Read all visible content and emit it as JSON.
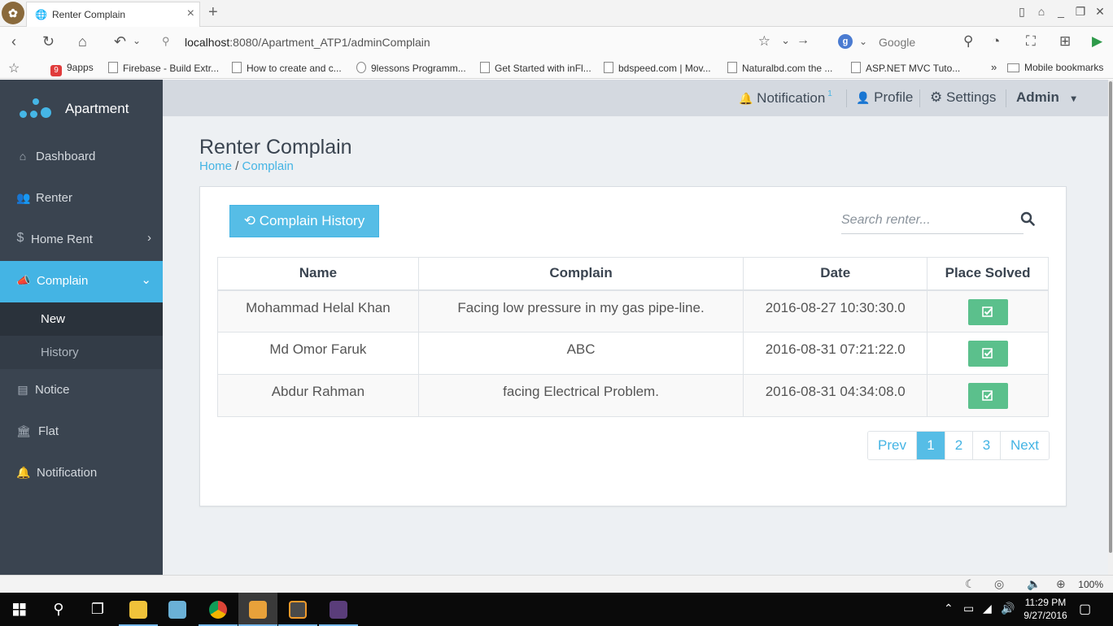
{
  "browser": {
    "tab_title": "Renter Complain",
    "url_host": "localhost",
    "url_rest": ":8080/Apartment_ATP1/adminComplain",
    "search_engine_label": "Google",
    "search_engine_badge": "g",
    "bookmarks": [
      {
        "label": "9apps",
        "badge": "9"
      },
      {
        "label": "Firebase - Build Extr..."
      },
      {
        "label": "How to create and c..."
      },
      {
        "label": "9lessons Programm..."
      },
      {
        "label": "Get Started with inFl..."
      },
      {
        "label": "bdspeed.com | Mov..."
      },
      {
        "label": "Naturalbd.com the ..."
      },
      {
        "label": "ASP.NET MVC Tuto..."
      }
    ],
    "bookmarks_overflow": "»",
    "mobile_bookmarks": "Mobile bookmarks",
    "zoom": "100%"
  },
  "sidebar": {
    "brand": "Apartment",
    "brand_color": "#45b6e6",
    "items": [
      {
        "label": "Dashboard",
        "icon": "home-icon"
      },
      {
        "label": "Renter",
        "icon": "users-icon"
      },
      {
        "label": "Home Rent",
        "icon": "dollar-icon"
      },
      {
        "label": "Complain",
        "icon": "bullhorn-icon"
      },
      {
        "label": "Notice",
        "icon": "file-icon"
      },
      {
        "label": "Flat",
        "icon": "bank-icon"
      },
      {
        "label": "Notification",
        "icon": "bell-icon"
      }
    ],
    "sub_items": [
      {
        "label": "New"
      },
      {
        "label": "History"
      }
    ]
  },
  "topbar": {
    "notification": "Notification",
    "notification_count": "1",
    "profile": "Profile",
    "settings": "Settings",
    "user": "Admin"
  },
  "page": {
    "title": "Renter Complain",
    "breadcrumb_home": "Home",
    "breadcrumb_sep": "/",
    "breadcrumb_current": "Complain",
    "history_button": "Complain History",
    "search_placeholder": "Search renter...",
    "columns": [
      "Name",
      "Complain",
      "Date",
      "Place Solved"
    ],
    "rows": [
      {
        "name": "Mohammad Helal Khan",
        "complain": "Facing low pressure in my gas pipe-line.",
        "date": "2016-08-27 10:30:30.0"
      },
      {
        "name": "Md Omor Faruk",
        "complain": "ABC",
        "date": "2016-08-31 07:21:22.0"
      },
      {
        "name": "Abdur Rahman",
        "complain": "facing Electrical Problem.",
        "date": "2016-08-31 04:34:08.0"
      }
    ],
    "pagination": {
      "prev": "Prev",
      "pages": [
        "1",
        "2",
        "3"
      ],
      "current": "1",
      "next": "Next"
    },
    "accent_color": "#44b4e4",
    "success_color": "#5bc08c"
  },
  "taskbar": {
    "time": "11:29 PM",
    "date": "9/27/2016"
  }
}
